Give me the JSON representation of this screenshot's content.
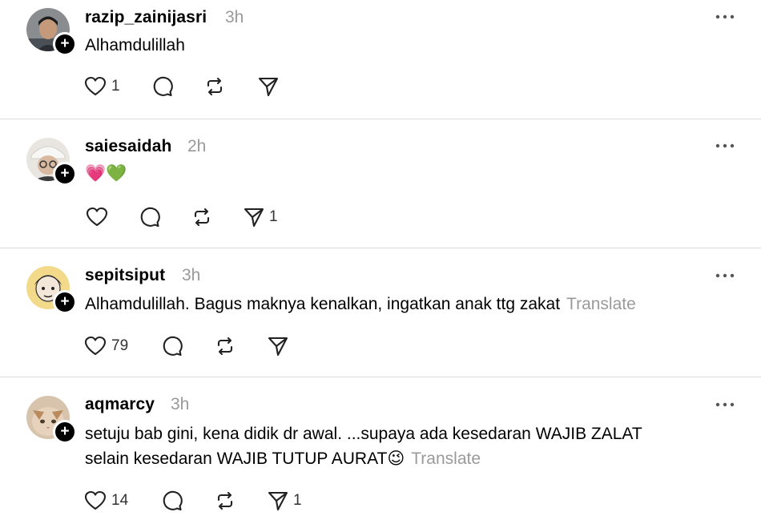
{
  "icons": {
    "like": "heart-icon",
    "reply": "comment-icon",
    "repost": "repost-icon",
    "share": "send-icon",
    "more": "more-icon",
    "follow": "plus-icon"
  },
  "translate_label": "Translate",
  "posts": [
    {
      "username": "razip_zainijasri",
      "time": "3h",
      "text": "Alhamdulillah",
      "likes": "1",
      "replies": "",
      "reposts": "",
      "shares": ""
    },
    {
      "username": "saiesaidah",
      "time": "2h",
      "text": "💗💚",
      "likes": "",
      "replies": "",
      "reposts": "",
      "shares": "1"
    },
    {
      "username": "sepitsiput",
      "time": "3h",
      "text": "Alhamdulillah. Bagus maknya kenalkan, ingatkan anak ttg zakat",
      "likes": "79",
      "replies": "",
      "reposts": "",
      "shares": ""
    },
    {
      "username": "aqmarcy",
      "time": "3h",
      "text_line1": "setuju bab gini, kena didik dr awal. ...supaya ada kesedaran WAJIB ZALAT",
      "text_line2": "selain kesedaran WAJIB TUTUP AURAT😉",
      "likes": "14",
      "replies": "",
      "reposts": "",
      "shares": "1"
    }
  ]
}
